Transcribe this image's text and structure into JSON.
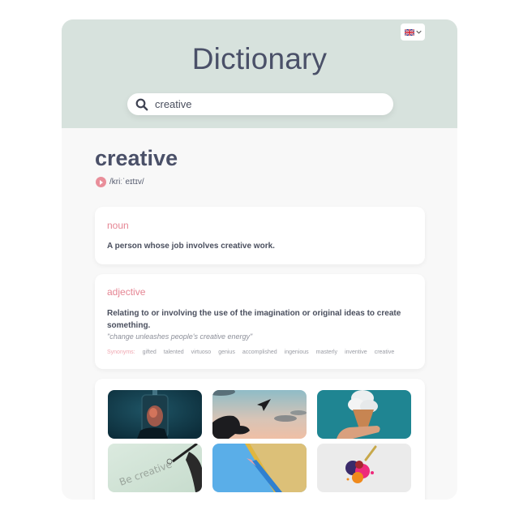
{
  "header": {
    "title": "Dictionary",
    "language": {
      "selected": "English (UK)",
      "icon": "uk-flag-icon"
    }
  },
  "search": {
    "value": "creative",
    "icon": "search-icon"
  },
  "entry": {
    "word": "creative",
    "phonetic": "/kriːˈeɪtɪv/",
    "meanings": [
      {
        "part_of_speech": "noun",
        "definition": "A person whose job involves creative work."
      },
      {
        "part_of_speech": "adjective",
        "definition": "Relating to or involving the use of the imagination or original ideas to create something.",
        "example": "\"change unleashes people's creative energy\"",
        "synonyms_label": "Synonyms:",
        "synonyms": [
          "gifted",
          "talented",
          "virtuoso",
          "genius",
          "accomplished",
          "ingenious",
          "masterly",
          "inventive",
          "creative"
        ]
      }
    ]
  },
  "images": [
    {
      "subject": "glowing jar under starry sky"
    },
    {
      "subject": "hand releasing paper plane at sunset"
    },
    {
      "subject": "hand holding ice cream cone with cloud"
    },
    {
      "subject": "hand writing 'Be creative' with lightbulb"
    },
    {
      "subject": "two colored pencils on blue and yellow"
    },
    {
      "subject": "colorful paint splash"
    }
  ],
  "colors": {
    "header_bg": "#d7e2dd",
    "accent_pink": "#e58593",
    "text_dark": "#4a5068"
  }
}
